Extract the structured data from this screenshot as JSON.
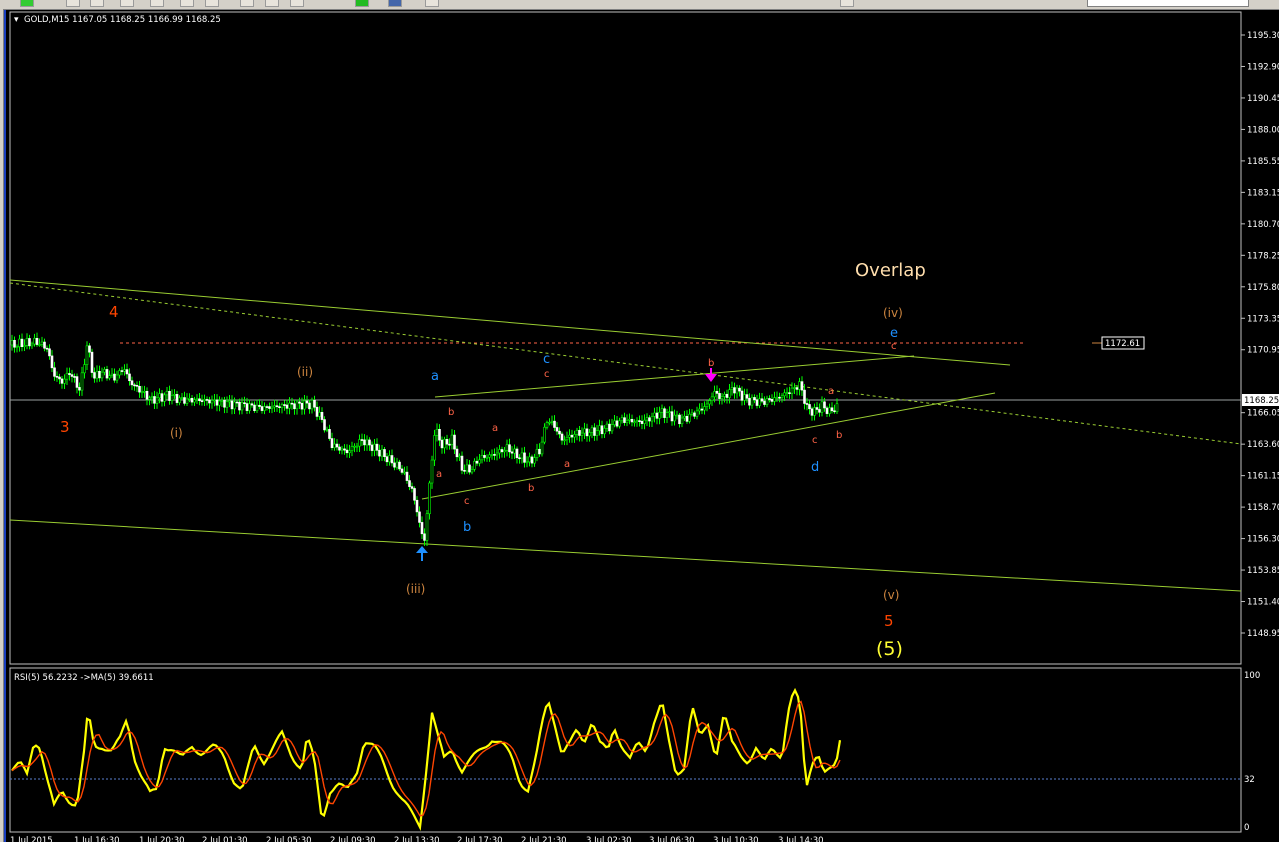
{
  "toolbar": {
    "buttons": 14
  },
  "main_chart": {
    "header": "GOLD,M15  1167.05 1168.25 1166.99 1168.25",
    "current_price_label": "1168.25",
    "marked_price_label": "1172.61",
    "overlap_label": "Overlap",
    "price_ticks": [
      "1195.30",
      "1192.90",
      "1190.45",
      "1188.00",
      "1185.55",
      "1183.15",
      "1180.70",
      "1178.25",
      "1175.80",
      "1173.35",
      "1170.95",
      "1168.25",
      "1166.05",
      "1163.60",
      "1161.15",
      "1158.70",
      "1156.30",
      "1153.85",
      "1151.40",
      "1148.95"
    ]
  },
  "wave_labels": {
    "w3": "3",
    "w4": "4",
    "w5": "5",
    "w5p": "(5)",
    "wi": "(i)",
    "wii": "(ii)",
    "wiii": "(iii)",
    "wiv": "(iv)",
    "wv": "(v)",
    "a": "a",
    "b": "b",
    "c": "c",
    "d": "d",
    "e": "e"
  },
  "colors": {
    "up": "#00ff00",
    "down": "#ffffff",
    "bull_wick": "#00ff00",
    "trendline": "#9acd32",
    "wave_major": "#ff4500",
    "wave_minor": "#cd853f",
    "wave_sub": "#1e90ff",
    "rsi": "#ffff00",
    "rsi_ma": "#ff4500"
  },
  "rsi_panel": {
    "header": "RSI(5) 56.2232  ->MA(5) 39.6611",
    "ticks": [
      "100",
      "32",
      "0"
    ]
  },
  "time_axis": {
    "labels": [
      "1 Jul 2015",
      "1 Jul 16:30",
      "1 Jul 20:30",
      "2 Jul 01:30",
      "2 Jul 05:30",
      "2 Jul 09:30",
      "2 Jul 13:30",
      "2 Jul 17:30",
      "2 Jul 21:30",
      "3 Jul 02:30",
      "3 Jul 06:30",
      "3 Jul 10:30",
      "3 Jul 14:30"
    ]
  }
}
